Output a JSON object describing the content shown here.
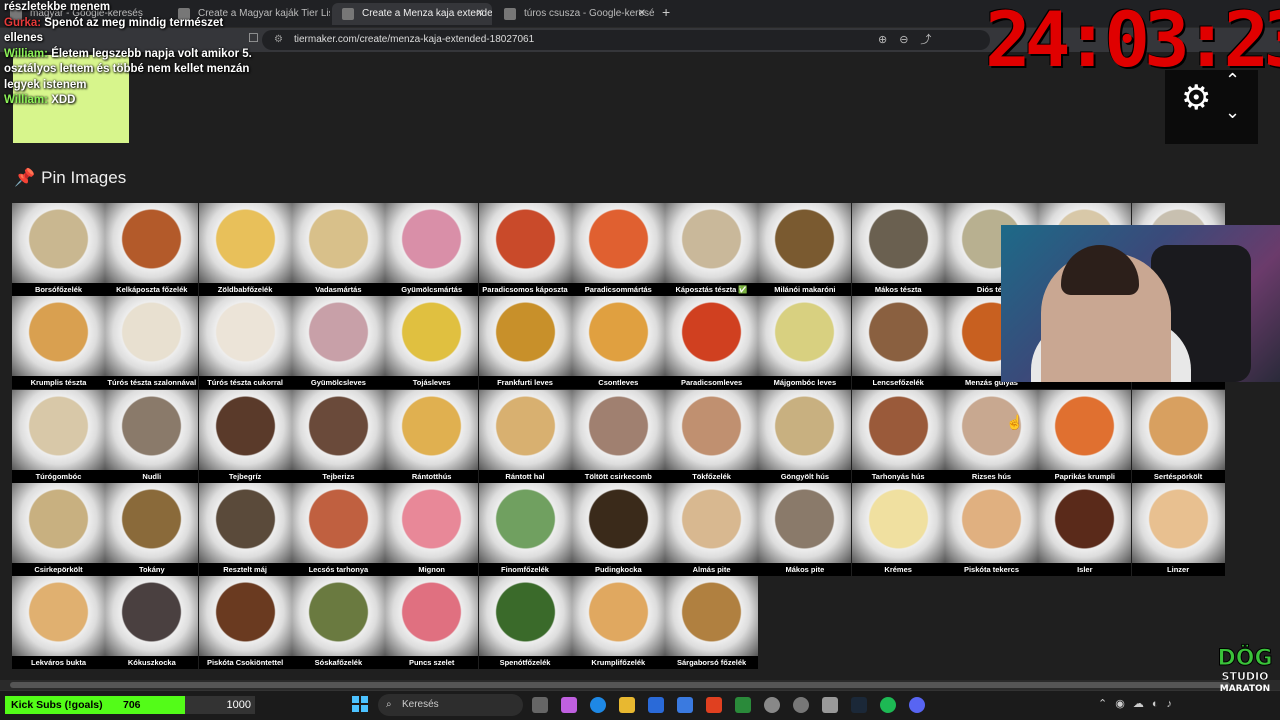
{
  "browser": {
    "tabs": [
      {
        "title": "magyar - Google-keresés",
        "active": false
      },
      {
        "title": "Create a Magyar kaják Tier List - Tier",
        "active": false
      },
      {
        "title": "Create a Menza kaja extended T",
        "active": true
      },
      {
        "title": "túros csusza - Google-keresés",
        "active": false
      }
    ],
    "url": "tiermaker.com/create/menza-kaja-extended-18027061"
  },
  "chat": [
    {
      "user": "",
      "text": "részletekbe menem"
    },
    {
      "user": "Gurka: ",
      "text": "Spenót az meg mindig természet ellenes"
    },
    {
      "user": "William: ",
      "text": "Életem legszebb napja volt amikor 5. osztályos lettem és többé nem kellet menzán legyek istenem"
    },
    {
      "user": "William: ",
      "text": "XDD"
    }
  ],
  "timer": "24:03:23",
  "section_title": "Pin Images",
  "items": [
    {
      "label": "Borsófőzelék",
      "color": "#c9b790"
    },
    {
      "label": "Kelkáposzta főzelék",
      "color": "#b35a2a"
    },
    {
      "label": "Zöldbabfőzelék",
      "color": "#e8c05a"
    },
    {
      "label": "Vadasmártás",
      "color": "#d8c08a"
    },
    {
      "label": "Gyümölcsmártás",
      "color": "#d98fa8"
    },
    {
      "label": "Paradicsomos káposzta",
      "color": "#c94a2a"
    },
    {
      "label": "Paradicsommártás",
      "color": "#e06030"
    },
    {
      "label": "Káposztás tészta ✅",
      "color": "#c9b89a"
    },
    {
      "label": "Milánói makaróni",
      "color": "#7a5a30"
    },
    {
      "label": "Mákos tészta",
      "color": "#6a6050"
    },
    {
      "label": "Diós tés",
      "color": "#b8b090"
    },
    {
      "label": "",
      "color": "#d8c8a8"
    },
    {
      "label": "",
      "color": "#c8c0b0"
    },
    {
      "label": "Krumplis tészta",
      "color": "#d9a050"
    },
    {
      "label": "Túrós tészta szalonnával",
      "color": "#e8e0d0"
    },
    {
      "label": "Túrós tészta cukorral",
      "color": "#ece4d8"
    },
    {
      "label": "Gyümölcsleves",
      "color": "#c8a0a8"
    },
    {
      "label": "Tojásleves",
      "color": "#e0c040"
    },
    {
      "label": "Frankfurti leves",
      "color": "#c8902a"
    },
    {
      "label": "Csontleves",
      "color": "#e0a040"
    },
    {
      "label": "Paradicsomleves",
      "color": "#d04020"
    },
    {
      "label": "Májgombóc leves",
      "color": "#d8d080"
    },
    {
      "label": "Lencsefőzelék",
      "color": "#8a6040"
    },
    {
      "label": "Menzás gulyás",
      "color": "#c86020"
    },
    {
      "label": "",
      "color": "#a07050"
    },
    {
      "label": "",
      "color": "#b08050"
    },
    {
      "label": "Túrógombóc",
      "color": "#d8c8a8"
    },
    {
      "label": "Nudli",
      "color": "#8a7a6a"
    },
    {
      "label": "Tejbegríz",
      "color": "#5a3a2a"
    },
    {
      "label": "Tejberizs",
      "color": "#6a4a3a"
    },
    {
      "label": "Rántotthús",
      "color": "#e0b050"
    },
    {
      "label": "Rántott hal",
      "color": "#d8b070"
    },
    {
      "label": "Töltött csirkecomb",
      "color": "#a08070"
    },
    {
      "label": "Tökfőzelék",
      "color": "#c09070"
    },
    {
      "label": "Göngyölt hús",
      "color": "#c8b080"
    },
    {
      "label": "Tarhonyás hús",
      "color": "#9a5a3a"
    },
    {
      "label": "Rizses hús",
      "color": "#c8a890"
    },
    {
      "label": "Paprikás krumpli",
      "color": "#e07030"
    },
    {
      "label": "Sertéspörkölt",
      "color": "#d8a060"
    },
    {
      "label": "Csirkepörkölt",
      "color": "#c8b080"
    },
    {
      "label": "Tokány",
      "color": "#8a6a3a"
    },
    {
      "label": "Resztelt máj",
      "color": "#5a4a3a"
    },
    {
      "label": "Lecsós tarhonya",
      "color": "#c06040"
    },
    {
      "label": "Mignon",
      "color": "#e88898"
    },
    {
      "label": "Finomfőzelék",
      "color": "#70a060"
    },
    {
      "label": "Pudingkocka",
      "color": "#3a2a1a"
    },
    {
      "label": "Almás pite",
      "color": "#d8b890"
    },
    {
      "label": "Mákos pite",
      "color": "#8a7a6a"
    },
    {
      "label": "Krémes",
      "color": "#f0e0a0"
    },
    {
      "label": "Piskóta tekercs",
      "color": "#e0b080"
    },
    {
      "label": "Isler",
      "color": "#5a2a1a"
    },
    {
      "label": "Linzer",
      "color": "#e8c090"
    },
    {
      "label": "Lekváros bukta",
      "color": "#e0b070"
    },
    {
      "label": "Kókuszkocka",
      "color": "#4a4040"
    },
    {
      "label": "Piskóta Csokiöntettel",
      "color": "#6a3a20"
    },
    {
      "label": "Sóskafőzelék",
      "color": "#6a7a40"
    },
    {
      "label": "Puncs szelet",
      "color": "#e07080"
    },
    {
      "label": "Spenótfőzelék",
      "color": "#3a6a2a"
    },
    {
      "label": "Krumplifőzelék",
      "color": "#e0a860"
    },
    {
      "label": "Sárgaborsó főzelék",
      "color": "#b08040"
    }
  ],
  "subs": {
    "label": "Kick Subs (!goals)",
    "count": "706",
    "goal": "1000"
  },
  "taskbar": {
    "search": "Keresés"
  },
  "watermark": {
    "line1": "DÖG",
    "line2": "STUDIO",
    "line3": "MARATON"
  }
}
